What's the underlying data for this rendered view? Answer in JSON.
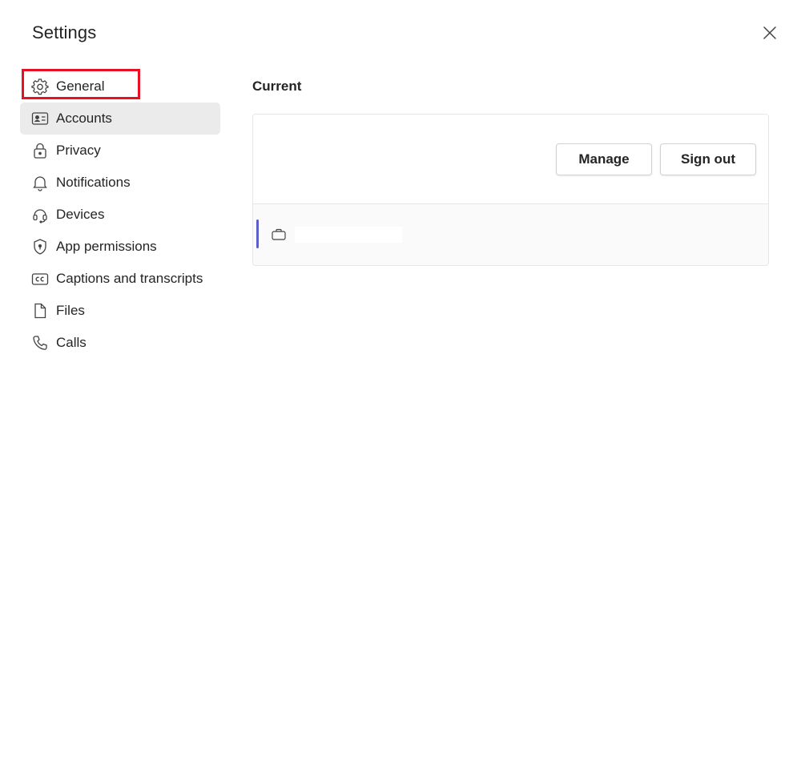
{
  "dialog": {
    "title": "Settings",
    "close_icon": "close-icon"
  },
  "sidebar": {
    "items": [
      {
        "label": "General",
        "icon": "gear-icon",
        "selected": false,
        "highlighted": true
      },
      {
        "label": "Accounts",
        "icon": "id-card-icon",
        "selected": true,
        "highlighted": false
      },
      {
        "label": "Privacy",
        "icon": "lock-icon",
        "selected": false,
        "highlighted": false
      },
      {
        "label": "Notifications",
        "icon": "bell-icon",
        "selected": false,
        "highlighted": false
      },
      {
        "label": "Devices",
        "icon": "headset-icon",
        "selected": false,
        "highlighted": false
      },
      {
        "label": "App permissions",
        "icon": "shield-icon",
        "selected": false,
        "highlighted": false
      },
      {
        "label": "Captions and transcripts",
        "icon": "closed-captions-icon",
        "selected": false,
        "highlighted": false
      },
      {
        "label": "Files",
        "icon": "document-icon",
        "selected": false,
        "highlighted": false
      },
      {
        "label": "Calls",
        "icon": "phone-icon",
        "selected": false,
        "highlighted": false
      }
    ]
  },
  "main": {
    "section_title": "Current",
    "buttons": {
      "manage": "Manage",
      "sign_out": "Sign out"
    },
    "account": {
      "icon": "briefcase-icon",
      "name": ""
    }
  },
  "colors": {
    "selected_bg": "#ebebeb",
    "highlight_border": "#e81123",
    "accent": "#5b5fc7"
  }
}
